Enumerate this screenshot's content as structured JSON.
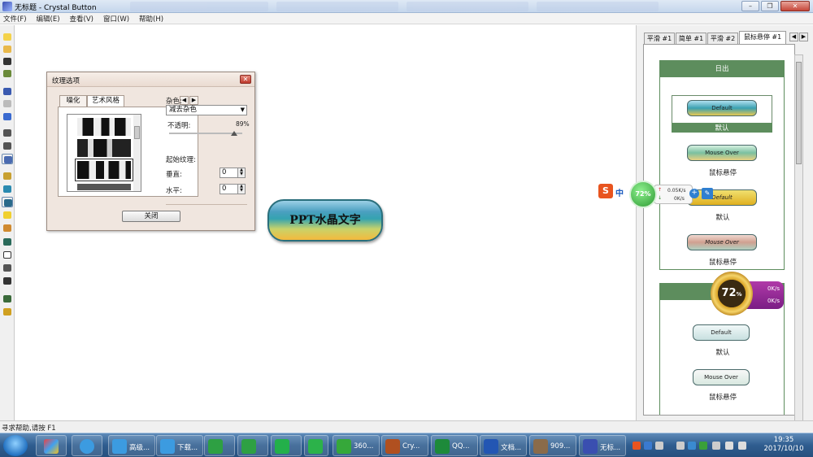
{
  "window": {
    "title": "无标题 - Crystal Button",
    "minimize": "–",
    "restore": "❐",
    "close": "✕"
  },
  "menu": [
    "文件(F)",
    "编辑(E)",
    "查看(V)",
    "窗口(W)",
    "帮助(H)"
  ],
  "dialog": {
    "title": "纹理选项",
    "tabs": [
      "噪化",
      "艺术风格"
    ],
    "noise_label": "杂色:",
    "noise_value": "减去杂色",
    "opacity_label": "不透明:",
    "opacity_value": "89%",
    "opacity_level": 0.89,
    "texture_start_label": "起始纹理:",
    "vertical_label": "垂直:",
    "vertical_value": "0",
    "horizontal_label": "水平:",
    "horizontal_value": "0",
    "close_button": "关闭"
  },
  "canvas_button": {
    "text": "PPT水晶文字"
  },
  "right_panel": {
    "tabs": [
      "平滑 #1",
      "简单 #1",
      "平滑 #2",
      "鼠标悬停 #1"
    ],
    "groups": [
      {
        "header": "日出",
        "samples": [
          {
            "text": "Default",
            "label": "默认"
          },
          {
            "text": "Mouse Over",
            "label": "鼠标悬停"
          },
          {
            "text": "Default",
            "label": "默认"
          },
          {
            "text": "Mouse Over",
            "label": "鼠标悬停"
          }
        ]
      },
      {
        "header": "",
        "samples": [
          {
            "text": "Default",
            "label": "默认"
          },
          {
            "text": "Mouse Over",
            "label": "鼠标悬停"
          }
        ]
      }
    ]
  },
  "overlays": {
    "ime": {
      "logo": "S",
      "mode": "中"
    },
    "netmon": {
      "percent": "72%",
      "up": "0.05K/s",
      "down": "0K/s"
    },
    "cat": {
      "percent": "72",
      "up": "0K/s",
      "down": "0K/s"
    }
  },
  "status_bar": {
    "text": "寻求帮助,请按 F1"
  },
  "taskbar": {
    "items": [
      {
        "label": "高级...",
        "color": "#3c9be0"
      },
      {
        "label": "下载...",
        "color": "#3c9be0"
      },
      {
        "label": "",
        "color": "#2ea043"
      },
      {
        "label": "",
        "color": "#2ea043"
      },
      {
        "label": "",
        "color": "#23b04a"
      },
      {
        "label": "",
        "color": "#2cb24a"
      },
      {
        "label": "360...",
        "color": "#36a83a"
      },
      {
        "label": "Cry...",
        "color": "#b05020"
      },
      {
        "label": "QQ...",
        "color": "#1d8a3a"
      },
      {
        "label": "文档...",
        "color": "#2356b3"
      },
      {
        "label": "909...",
        "color": "#8a6b4a"
      },
      {
        "label": "无标...",
        "color": "#3a4fb0"
      }
    ],
    "clock_time": "19:35",
    "clock_date": "2017/10/10"
  }
}
